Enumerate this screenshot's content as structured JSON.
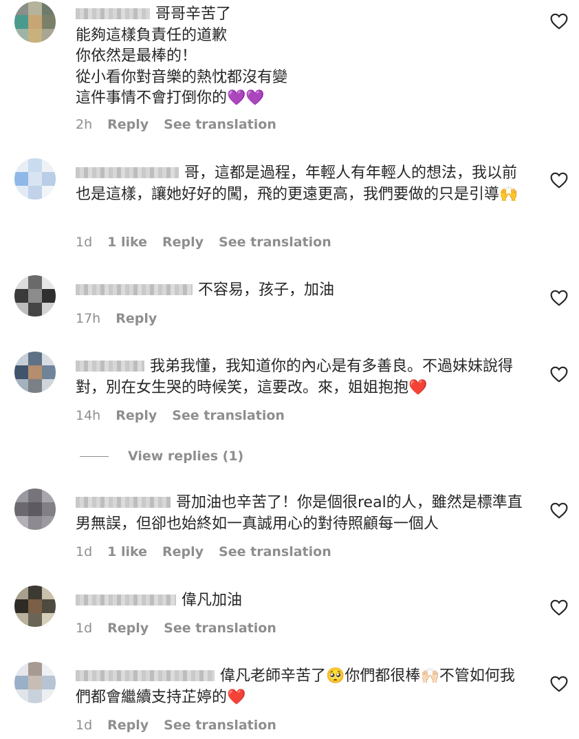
{
  "comments": [
    {
      "text": "哥哥辛苦了\n能夠這樣負責任的道歉\n你依然是最棒的！\n從小看你對音樂的熱忱都沒有變\n這件事情不會打倒你的",
      "emoji": "💜💜",
      "time": "2h",
      "likes": "",
      "reply": "Reply",
      "translate": "See translation"
    },
    {
      "text": "哥，這都是過程，年輕人有年輕人的想法，我以前也是這樣，讓她好好的闖，飛的更遠更高，我們要做的只是引導",
      "emoji": "🙌",
      "time": "1d",
      "likes": "1 like",
      "reply": "Reply",
      "translate": "See translation"
    },
    {
      "text": "不容易，孩子，加油",
      "emoji": "",
      "time": "17h",
      "likes": "",
      "reply": "Reply",
      "translate": ""
    },
    {
      "text": "我弟我懂，我知道你的內心是有多善良。不過妹妹說得對，別在女生哭的時候笑，這要改。來，姐姐抱抱",
      "emoji": "❤️",
      "time": "14h",
      "likes": "",
      "reply": "Reply",
      "translate": "See translation"
    },
    {
      "text": "哥加油也辛苦了！你是個很real的人，雖然是標準直男無誤，但卻也始終如一真誠用心的對待照顧每一個人",
      "emoji": "",
      "time": "1d",
      "likes": "1 like",
      "reply": "Reply",
      "translate": "See translation"
    },
    {
      "text": "偉凡加油",
      "emoji": "",
      "time": "1d",
      "likes": "",
      "reply": "Reply",
      "translate": "See translation"
    },
    {
      "text_part1": "偉凡老師辛苦了",
      "emoji1": "🥺",
      "text_part2": "你們都很棒",
      "emoji2": "🙌🏻",
      "text_part3": "不管如何我們都會繼續支持芷婷的",
      "emoji3": "❤️",
      "time": "1d",
      "likes": "",
      "reply": "Reply",
      "translate": "See translation"
    }
  ],
  "view_replies": "View replies (1)",
  "colors": {
    "text": "#262626",
    "meta": "#8e8e8e",
    "heart_purple": "#8b3bd9",
    "heart_red": "#e0102a"
  }
}
